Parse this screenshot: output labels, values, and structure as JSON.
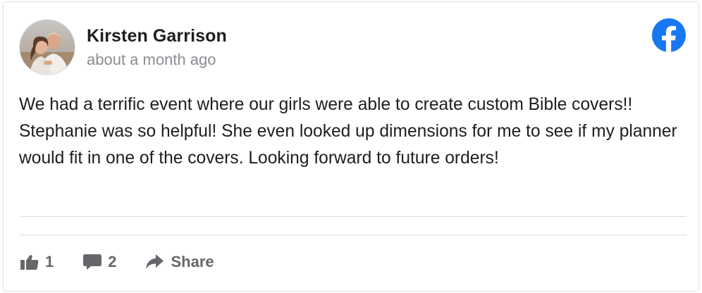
{
  "post": {
    "author": "Kirsten Garrison",
    "timestamp": "about a month ago",
    "text": "We had a terrific event where our girls were able to create custom Bible covers!! Stephanie was so helpful! She even looked up dimensions for me to see if my planner would fit in one of the covers. Looking forward to future orders!"
  },
  "actions": {
    "like_count": "1",
    "comment_count": "2",
    "share_label": "Share"
  },
  "icons": {
    "brand": "facebook-icon",
    "like": "thumbs-up-icon",
    "comment": "comment-bubble-icon",
    "share": "share-arrow-icon"
  },
  "colors": {
    "facebook_blue": "#1877f2",
    "action_gray": "#65676b",
    "timestamp_gray": "#8a8d91",
    "divider": "#dadde1"
  }
}
